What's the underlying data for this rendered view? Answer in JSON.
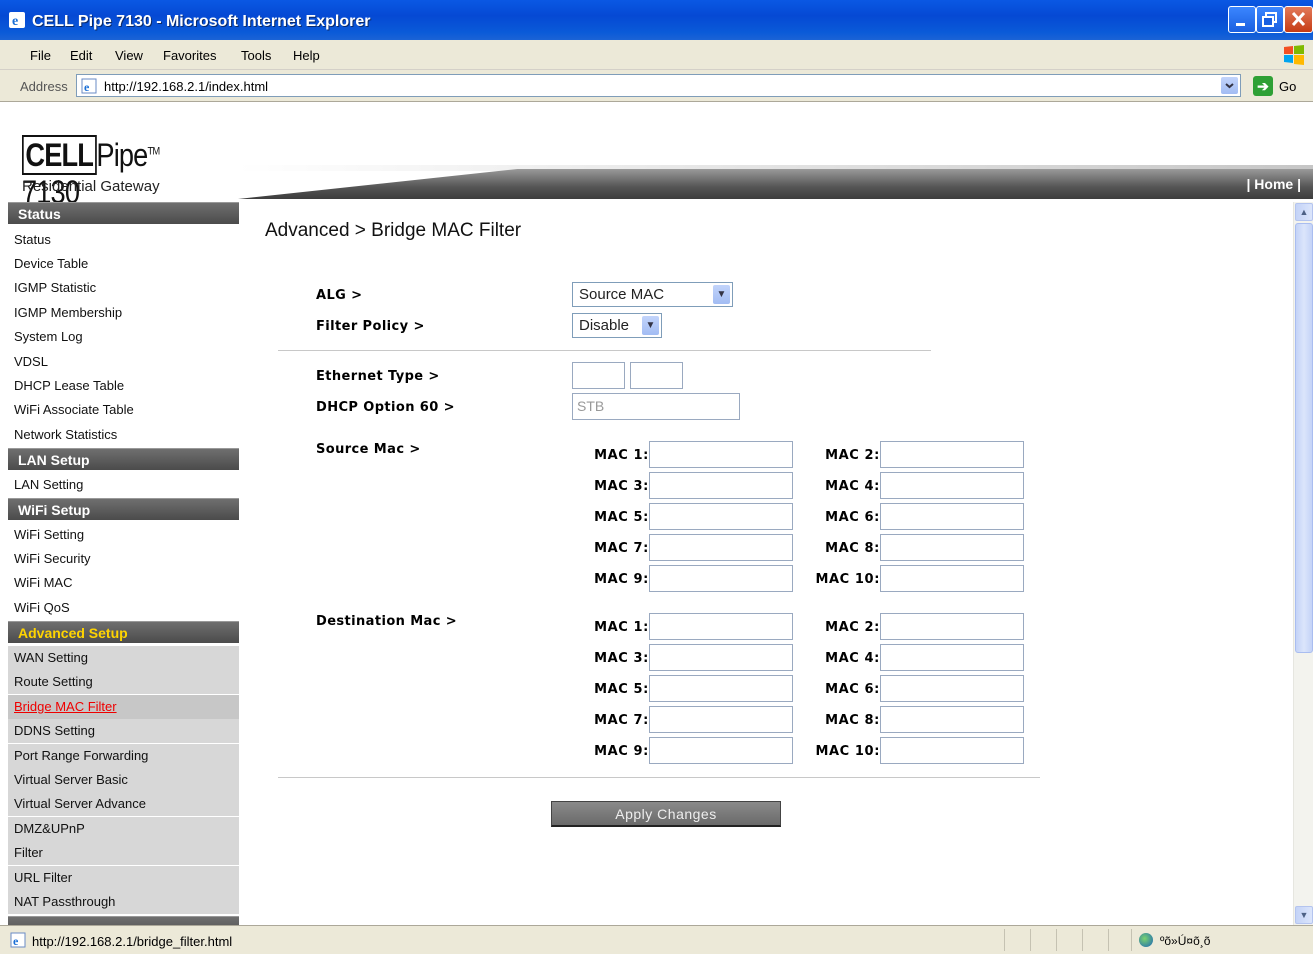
{
  "window": {
    "title": "CELL Pipe 7130 - Microsoft Internet Explorer"
  },
  "menu": {
    "items": [
      "File",
      "Edit",
      "View",
      "Favorites",
      "Tools",
      "Help"
    ]
  },
  "address": {
    "label": "Address",
    "url": "http://192.168.2.1/index.html",
    "go_label": "Go"
  },
  "header": {
    "brand_cell": "CELL",
    "brand_pipe": "Pipe",
    "brand_tm": "TM",
    "brand_model": " 7130",
    "subtitle": "Residential Gateway",
    "home_link": "| Home |"
  },
  "sidebar": {
    "status_head": "Status",
    "status_items": [
      "Status",
      "Device Table",
      "IGMP Statistic",
      "IGMP Membership",
      "System Log",
      "VDSL",
      "DHCP Lease Table",
      "WiFi Associate Table",
      "Network Statistics"
    ],
    "lan_head": "LAN Setup",
    "lan_items": [
      "LAN Setting"
    ],
    "wifi_head": "WiFi Setup",
    "wifi_items": [
      "WiFi Setting",
      "WiFi Security",
      "WiFi MAC",
      "WiFi QoS"
    ],
    "adv_head": "Advanced Setup",
    "adv_items": [
      "WAN Setting",
      "Route Setting",
      "Bridge MAC Filter",
      "DDNS Setting",
      "Port Range Forwarding",
      "Virtual Server Basic",
      "Virtual Server Advance",
      "DMZ&UPnP",
      "Filter",
      "URL Filter",
      "NAT Passthrough"
    ],
    "active_item": "Bridge MAC Filter"
  },
  "content": {
    "page_title": "Advanced > Bridge MAC Filter",
    "alg_label": "ALG >",
    "alg_value": "Source MAC",
    "filter_policy_label": "Filter Policy >",
    "filter_policy_value": "Disable",
    "ethernet_type_label": "Ethernet Type >",
    "dhcp_option_label": "DHCP Option 60 >",
    "dhcp_option_value": "STB",
    "source_mac_label": "Source Mac >",
    "dest_mac_label": "Destination Mac >",
    "mac_labels": [
      "MAC 1:",
      "MAC 2:",
      "MAC 3:",
      "MAC 4:",
      "MAC 5:",
      "MAC 6:",
      "MAC 7:",
      "MAC 8:",
      "MAC 9:",
      "MAC 10:"
    ],
    "apply_label": "Apply Changes"
  },
  "statusbar": {
    "text": "http://192.168.2.1/bridge_filter.html",
    "zone": "ºõ»Ú¤õ¸õ"
  },
  "colors": {
    "titlebar": "#0549d4",
    "sidebar_head": "#5a5a5a",
    "advanced_head_text": "#ffd400",
    "active_link": "#e00000"
  }
}
